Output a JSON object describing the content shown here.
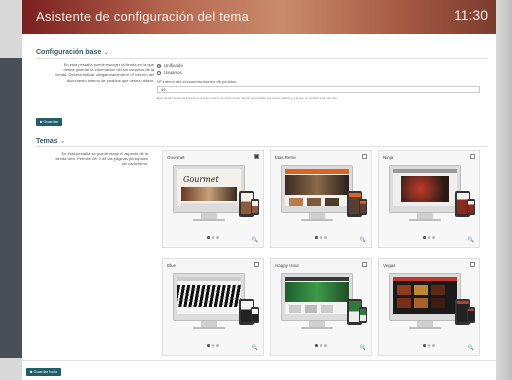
{
  "header": {
    "title": "Asistente de configuración del tema",
    "time": "11:30"
  },
  "base_config": {
    "title": "Configuración base",
    "description": "En esta pestaña puede escoger la tienda en la que desea guardar la información del sin usuarios de la tienda. Deberá indicar obligatoriamente el nº interno del documento interno de pedidos que desea utilizar.",
    "options": [
      {
        "label": "Unificado",
        "selected": true
      },
      {
        "label": "Usuarios",
        "selected": false
      }
    ],
    "field_label": "Nº interno del documento interno de pedidos",
    "field_value": "10",
    "hint": "Este pedido aparecerá sobre la sección interno del documento interno de pedidos que desea utilizar y a la que se nombra este ejemplo.",
    "save_label": "Guardar"
  },
  "themes": {
    "title": "Temas",
    "description": "En esta pestaña se puede elegir el aspecto de la tienda web. Permite ver 3 de las páginas principales del cada tema.",
    "cards": [
      {
        "name": "Gourmet",
        "checked": true,
        "screen_text": "Gourmet"
      },
      {
        "name": "Mas Retro",
        "checked": false
      },
      {
        "name": "Ninja",
        "checked": false
      },
      {
        "name": "Blue",
        "checked": false
      },
      {
        "name": "Happy Hour",
        "checked": false
      },
      {
        "name": "Vegas",
        "checked": false
      }
    ]
  },
  "footer": {
    "save_all_label": "Guardar todo"
  }
}
